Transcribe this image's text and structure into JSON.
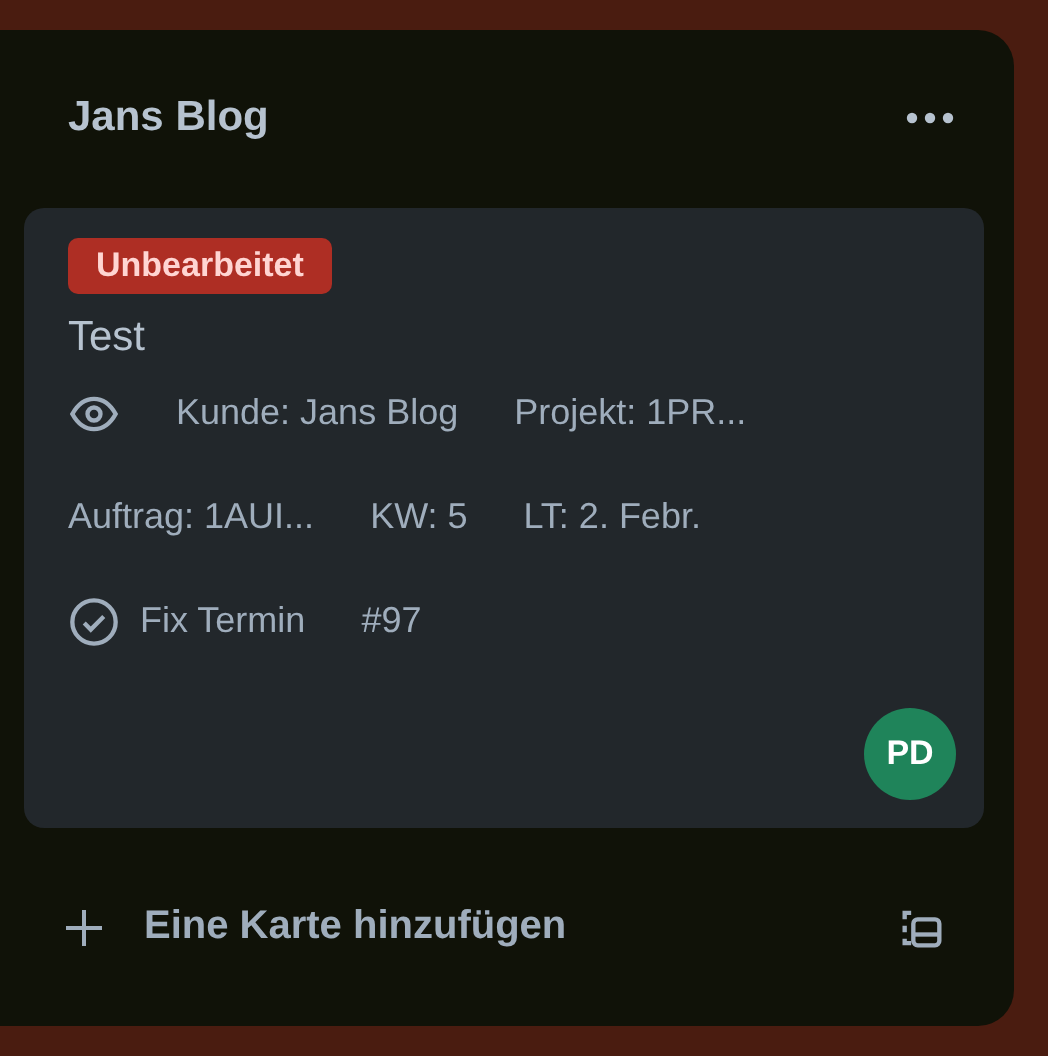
{
  "list": {
    "title": "Jans Blog",
    "cards": [
      {
        "label": {
          "text": "Unbearbeitet",
          "color": "#ae2e24"
        },
        "title": "Test",
        "rows": [
          [
            {
              "kind": "watch"
            },
            {
              "kind": "text",
              "text": "Kunde: Jans Blog"
            },
            {
              "kind": "text",
              "text": "Projekt: 1PR..."
            }
          ],
          [
            {
              "kind": "text",
              "text": "Auftrag: 1AUI..."
            },
            {
              "kind": "text",
              "text": "KW: 5"
            },
            {
              "kind": "text",
              "text": "LT: 2. Febr."
            }
          ],
          [
            {
              "kind": "checked",
              "text": "Fix Termin"
            },
            {
              "kind": "text",
              "text": "#97"
            }
          ]
        ],
        "members": [
          {
            "initials": "PD",
            "color": "#1f845a"
          }
        ]
      }
    ],
    "add_card": "Eine Karte hinzufügen"
  }
}
